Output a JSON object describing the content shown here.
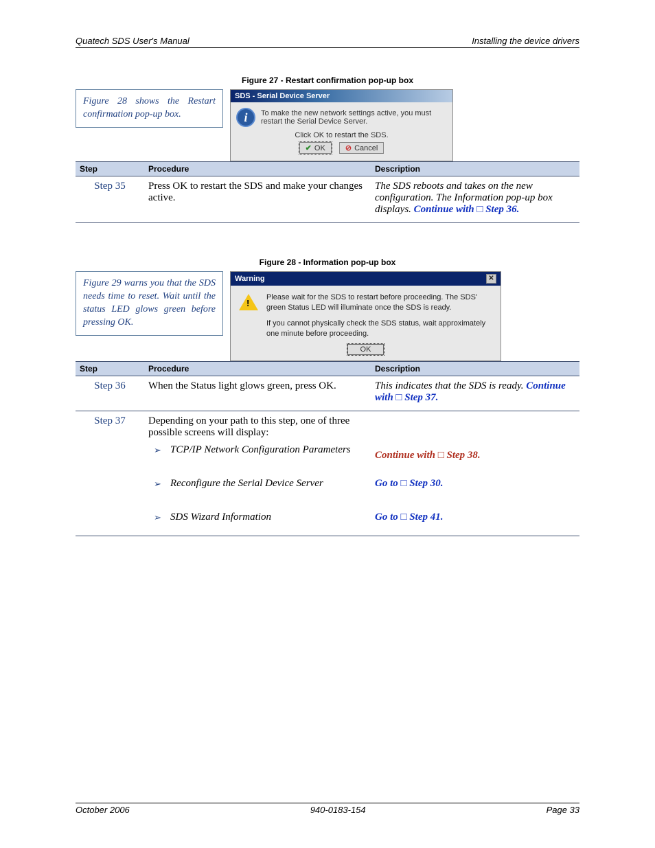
{
  "header": {
    "left": "Quatech SDS User's Manual",
    "right": "Installing the device drivers"
  },
  "figure27": {
    "caption": "Figure 27 - Restart confirmation pop-up box",
    "callout": "Figure 28 shows the Restart confirmation pop-up box.",
    "dialog": {
      "title": "SDS - Serial Device Server",
      "msg": "To make the new network settings active, you must restart the Serial Device Server.",
      "sub": "Click OK to restart the SDS.",
      "ok": "OK",
      "cancel": "Cancel"
    }
  },
  "table1": {
    "headers": {
      "step": "Step",
      "proc": "Procedure",
      "desc": "Description"
    },
    "row": {
      "step": "Step 35",
      "proc": "Press OK to restart the SDS and make your changes active.",
      "desc_pre": "The SDS reboots and takes on the new configuration. The Information pop-up box displays. ",
      "desc_link": "Continue with □ Step 36."
    }
  },
  "figure28": {
    "caption": "Figure 28 - Information pop-up box",
    "callout": "Figure 29 warns you that the SDS needs time to reset. Wait until the status LED glows green before pressing OK.",
    "dialog": {
      "title": "Warning",
      "p1": "Please wait for the SDS to restart before proceeding.  The SDS' green Status LED will illuminate once the SDS is ready.",
      "p2": "If you cannot physically check the SDS status, wait approximately one minute before proceeding.",
      "ok": "OK"
    }
  },
  "table2": {
    "headers": {
      "step": "Step",
      "proc": "Procedure",
      "desc": "Description"
    },
    "rows": [
      {
        "step": "Step 36",
        "proc": "When the Status light glows green, press OK.",
        "desc_pre": "This indicates that the SDS is ready. ",
        "desc_link": "Continue with □ Step 37."
      },
      {
        "step": "Step 37",
        "proc_intro": "Depending on your path to this step, one of three possible screens will display:",
        "opts": [
          {
            "label": "TCP/IP Network Configuration Parameters",
            "link": "Continue with □ Step 38.",
            "cls": "linkred"
          },
          {
            "label": "Reconfigure the Serial Device Server",
            "link": "Go to □ Step 30.",
            "cls": "link"
          },
          {
            "label": "SDS Wizard Information",
            "link": "Go to □ Step 41.",
            "cls": "link"
          }
        ]
      }
    ]
  },
  "footer": {
    "left": "October 2006",
    "center": "940-0183-154",
    "right": "Page 33"
  }
}
